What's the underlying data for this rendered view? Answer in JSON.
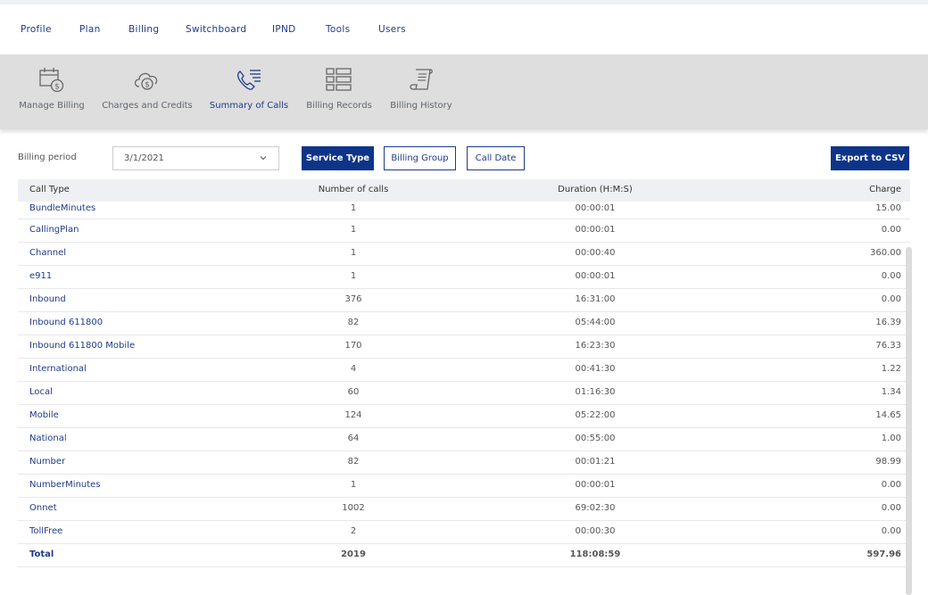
{
  "nav": {
    "items": [
      "Profile",
      "Plan",
      "Billing",
      "Switchboard",
      "IPND",
      "Tools",
      "Users"
    ]
  },
  "subnav": {
    "items": [
      {
        "label": "Manage Billing",
        "icon": "calendar-dollar-icon"
      },
      {
        "label": "Charges and Credits",
        "icon": "cloud-dollar-icon"
      },
      {
        "label": "Summary of Calls",
        "icon": "phone-list-icon"
      },
      {
        "label": "Billing Records",
        "icon": "records-grid-icon"
      },
      {
        "label": "Billing History",
        "icon": "scroll-document-icon"
      }
    ],
    "active": "Summary of Calls"
  },
  "filters": {
    "billing_period_label": "Billing period",
    "billing_period_value": "3/1/2021",
    "service_type": "Service Type",
    "billing_group": "Billing Group",
    "call_date": "Call Date",
    "export": "Export to CSV"
  },
  "table": {
    "headers": [
      "Call Type",
      "Number of calls",
      "Duration (H:M:S)",
      "Charge"
    ],
    "rows": [
      [
        "BundleMinutes",
        "1",
        "00:00:01",
        "15.00"
      ],
      [
        "CallingPlan",
        "1",
        "00:00:01",
        "0.00"
      ],
      [
        "Channel",
        "1",
        "00:00:40",
        "360.00"
      ],
      [
        "e911",
        "1",
        "00:00:01",
        "0.00"
      ],
      [
        "Inbound",
        "376",
        "16:31:00",
        "0.00"
      ],
      [
        "Inbound 611800",
        "82",
        "05:44:00",
        "16.39"
      ],
      [
        "Inbound 611800 Mobile",
        "170",
        "16:23:30",
        "76.33"
      ],
      [
        "International",
        "4",
        "00:41:30",
        "1.22"
      ],
      [
        "Local",
        "60",
        "01:16:30",
        "1.34"
      ],
      [
        "Mobile",
        "124",
        "05:22:00",
        "14.65"
      ],
      [
        "National",
        "64",
        "00:55:00",
        "1.00"
      ],
      [
        "Number",
        "82",
        "00:01:21",
        "98.99"
      ],
      [
        "NumberMinutes",
        "1",
        "00:00:01",
        "0.00"
      ],
      [
        "Onnet",
        "1002",
        "69:02:30",
        "0.00"
      ],
      [
        "TollFree",
        "2",
        "00:00:30",
        "0.00"
      ]
    ],
    "total": [
      "Total",
      "2019",
      "118:08:59",
      "597.96"
    ]
  },
  "colors": {
    "brand": "#0d3489",
    "link": "#1f3a8c",
    "subnav_bg": "#dedede"
  }
}
